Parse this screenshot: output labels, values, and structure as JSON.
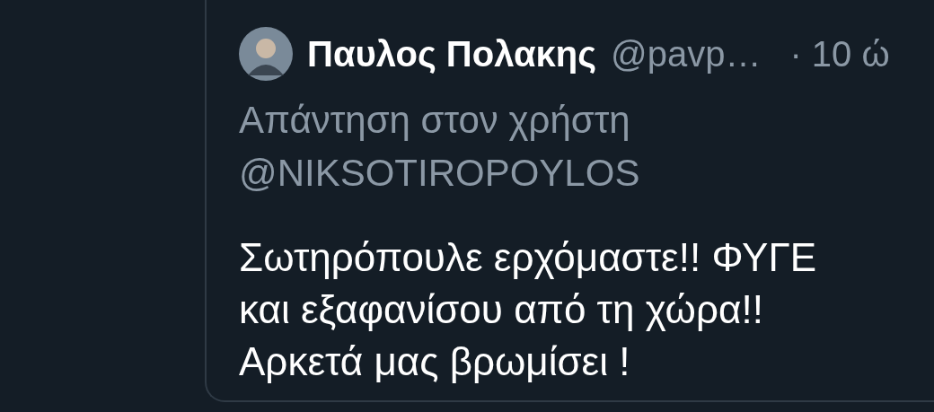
{
  "tweet": {
    "author": {
      "name": "Παυλος Πολακης",
      "handle": "@pavp…",
      "time": "· 10 ώ"
    },
    "reply_to": "Απάντηση στον χρήστη @NIKSOTIROPOYLOS",
    "text_lines": [
      "Σωτηρόπουλε ερχόμαστε!! ΦΥΓΕ",
      "και εξαφανίσου από τη χώρα!!",
      "Αρκετά μας βρωμίσει !"
    ]
  }
}
